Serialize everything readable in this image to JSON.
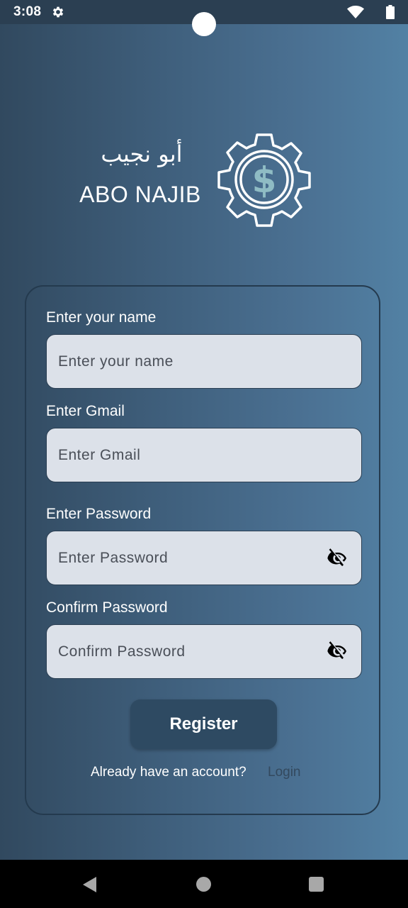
{
  "status_bar": {
    "time": "3:08",
    "icons": [
      "gear-icon",
      "wifi-icon",
      "battery-icon"
    ]
  },
  "brand": {
    "arabic_name": "أبو نجيب",
    "name": "ABO NAJIB",
    "logo_icon": "gear-dollar-icon",
    "logo_accent": "#8fbcc4"
  },
  "form": {
    "name_label": "Enter your name",
    "name_placeholder": "Enter your name",
    "gmail_label": "Enter Gmail",
    "gmail_placeholder": "Enter Gmail",
    "password_label": "Enter Password",
    "password_placeholder": "Enter Password",
    "confirm_label": "Confirm Password",
    "confirm_placeholder": "Confirm Password",
    "visibility_icon": "eye-off-icon",
    "register_label": "Register",
    "already_text": "Already have an account?",
    "login_label": "Login"
  },
  "colors": {
    "background_start": "#31495f",
    "background_end": "#5281a4",
    "input_fill": "#dce1e9",
    "button_fill": "#2e4a62"
  }
}
